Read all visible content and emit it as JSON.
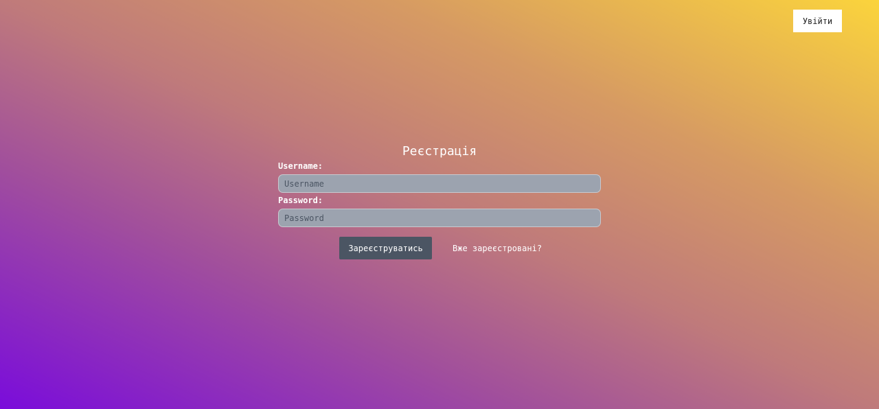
{
  "header": {
    "login_label": "Увійти"
  },
  "form": {
    "title": "Реєстрація",
    "username_label": "Username:",
    "username_placeholder": "Username",
    "password_label": "Password:",
    "password_placeholder": "Password",
    "submit_label": "Зареєструватись",
    "already_registered_link": "Вже зареєстровані?"
  },
  "colors": {
    "gradient_start": "#7a0cdb",
    "gradient_end": "#fbd43c",
    "button": "#4b5563",
    "input_bg": "#9ca3af"
  }
}
